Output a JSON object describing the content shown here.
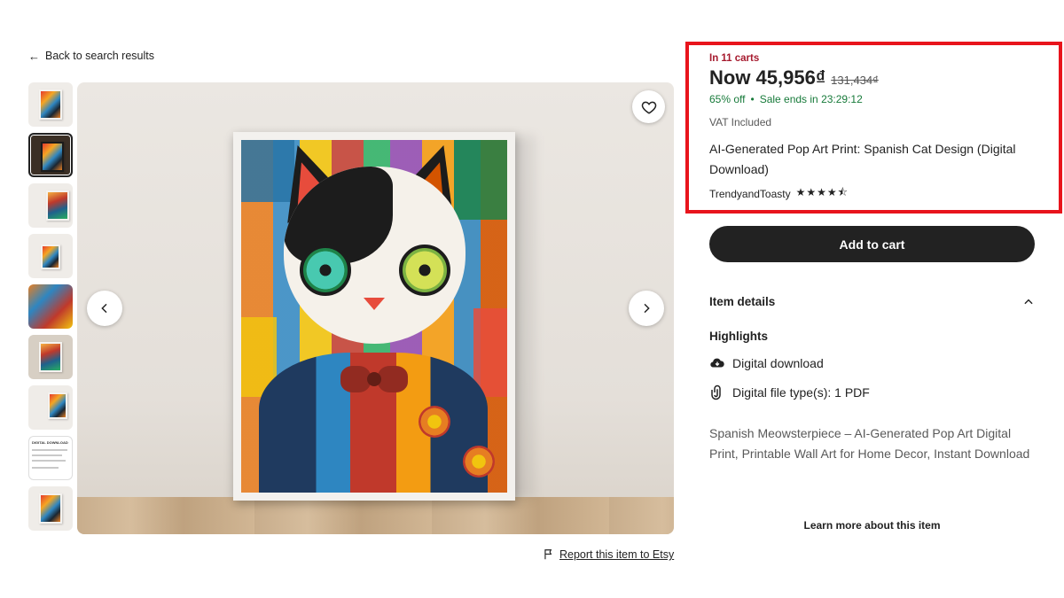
{
  "nav": {
    "back_label": "Back to search results"
  },
  "gallery": {
    "thumbnail_count": 9,
    "selected_index": 1,
    "doc_thumb_title": "DIGITAL DOWNLOAD"
  },
  "listing": {
    "in_carts": "In 11 carts",
    "price_now": "Now 45,956₫",
    "price_original": "131,434₫",
    "discount": "65% off",
    "sale_ends": "Sale ends in 23:29:12",
    "vat": "VAT Included",
    "title": "AI-Generated Pop Art Print: Spanish Cat Design (Digital Download)",
    "shop_name": "TrendyandToasty",
    "rating": 4.5,
    "stars_glyphs": "★★★★⯪"
  },
  "actions": {
    "add_to_cart": "Add to cart",
    "report": "Report this item to Etsy"
  },
  "details": {
    "heading": "Item details",
    "highlights_heading": "Highlights",
    "features": [
      {
        "icon": "cloud-download-icon",
        "label": "Digital download"
      },
      {
        "icon": "paperclip-icon",
        "label": "Digital file type(s): 1 PDF"
      }
    ],
    "description": "Spanish Meowsterpiece – AI-Generated Pop Art Digital Print, Printable Wall Art for Home Decor, Instant Download",
    "learn_more": "Learn more about this item"
  },
  "colors": {
    "highlight_border": "#e8141c",
    "sale_green": "#177a3a",
    "cart_red": "#a61a2e",
    "button_dark": "#222222"
  }
}
